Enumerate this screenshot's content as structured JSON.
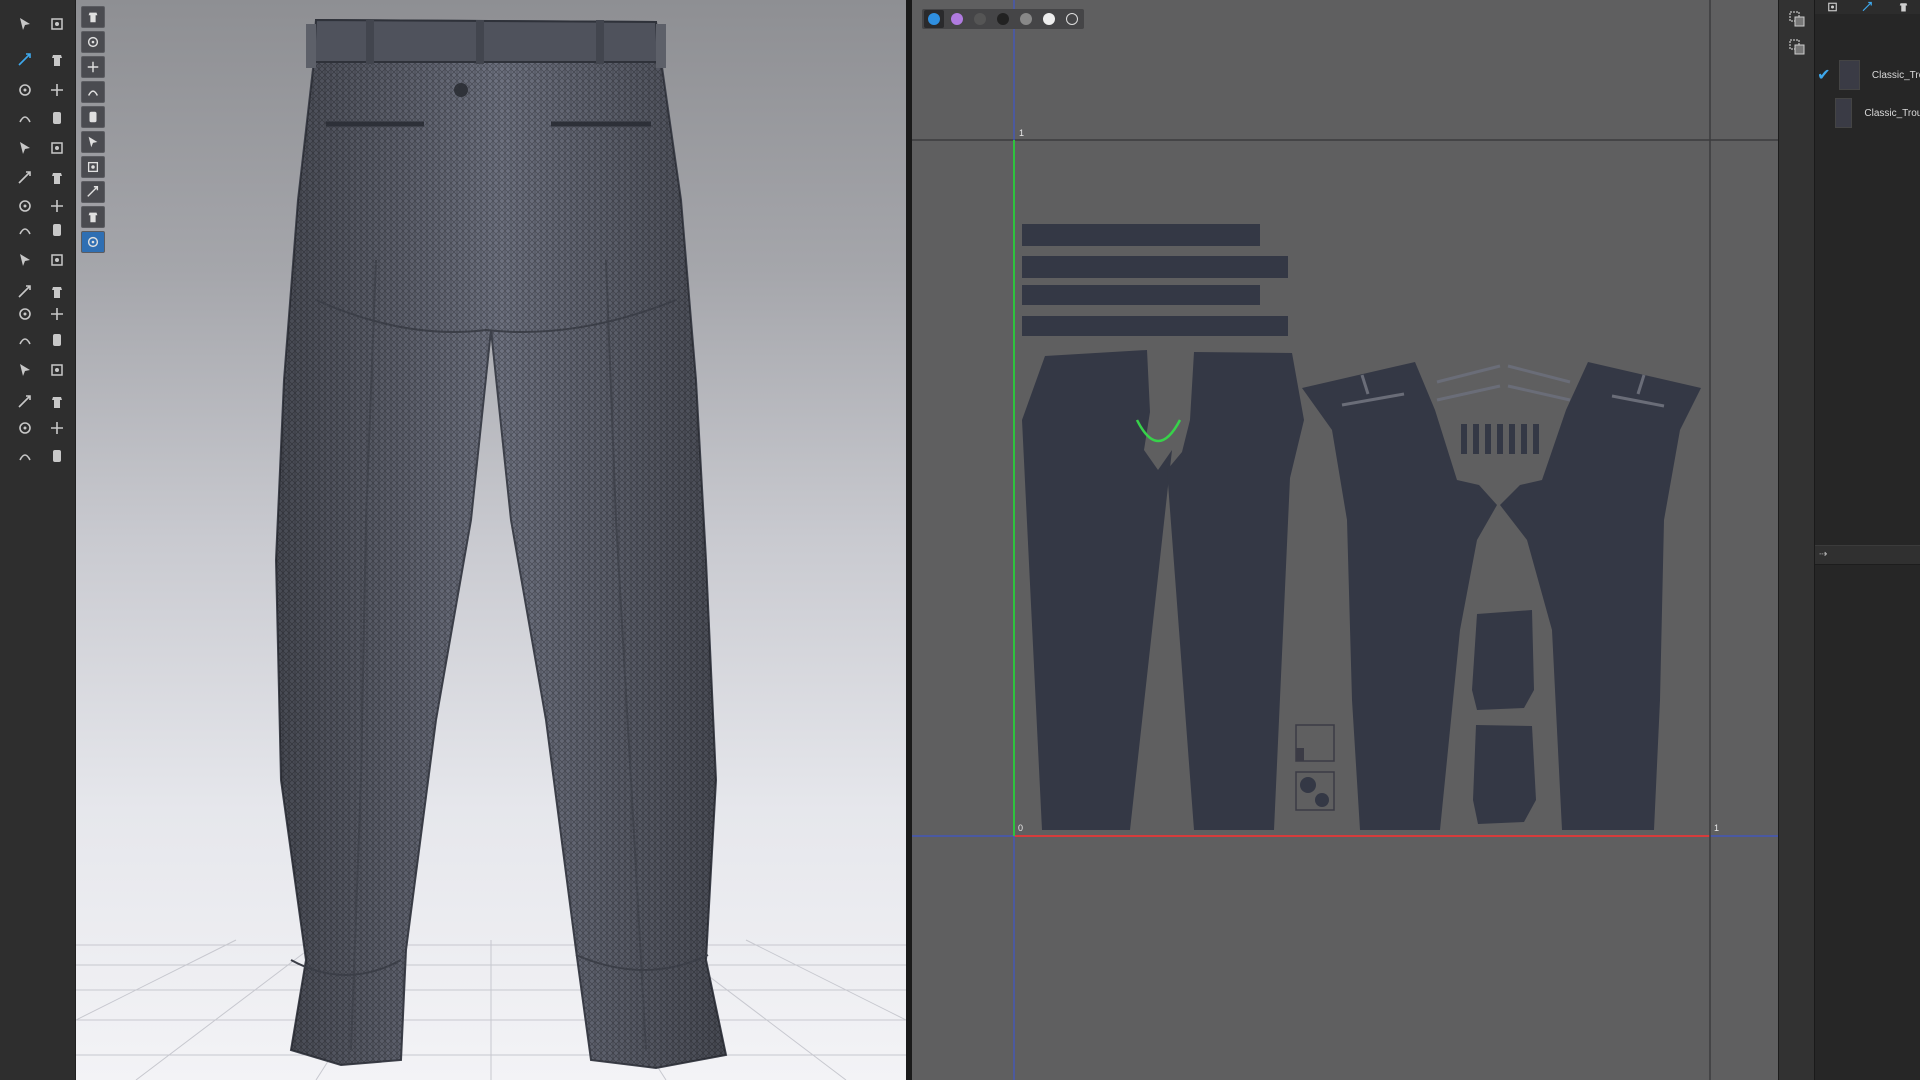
{
  "colors": {
    "pattern_fill": "#343845",
    "seam_highlight": "#37d24a",
    "axis_vertical": "#2ec43e",
    "axis_horizontal": "#d63c3c",
    "selection_check": "#3ea8ec"
  },
  "tool_strip": {
    "tools": [
      "select-move-icon",
      "edit-pattern-icon",
      "transform-pattern-icon",
      "edit-curve-point-icon",
      "add-point-icon",
      "edit-curvature-icon",
      "polygon-icon",
      "rectangle-icon",
      "ellipse-icon",
      "internal-polygon-icon",
      "internal-rectangle-icon",
      "internal-circle-icon",
      "dart-icon",
      "segment-sewing-icon",
      "free-sewing-icon",
      "edit-sewing-icon",
      "fold-arrangement-icon",
      "pin-icon",
      "tack-icon",
      "button-icon",
      "buttonhole-icon",
      "zipper-icon",
      "piping-icon",
      "elastic-icon",
      "topstitch-icon",
      "puckering-icon",
      "texture-edit-icon",
      "graphic-icon",
      "trim-icon",
      "avatar-measure-icon",
      "garment-fit-icon",
      "fold-icon"
    ]
  },
  "viewport_3d": {
    "tools": [
      "simulation-icon",
      "avatar-pose-icon",
      "select-mesh-icon",
      "fabric-icon",
      "avatar-visibility-icon",
      "garment-texture-icon",
      "mesh-quality-icon",
      "avatar-stretch-icon",
      "arrangement-icon",
      "measure-icon"
    ]
  },
  "viewport_2d": {
    "view_modes": [
      "texture-surface-icon",
      "thick-texture-icon",
      "mesh-shaded-icon",
      "dark-shaded-icon",
      "stress-map-icon",
      "white-surface-icon",
      "mesh-wireframe-icon"
    ],
    "axis_labels": {
      "top_left": "1",
      "bottom_left": "0",
      "bottom_right": "1"
    }
  },
  "mini_tools": [
    "uv-select-icon",
    "uv-transform-icon"
  ],
  "object_panel": {
    "tabs": [
      "list-icon",
      "fabric-tab-icon",
      "settings-icon"
    ],
    "items": [
      {
        "label": "Classic_Trouser",
        "checked": true
      },
      {
        "label": "Classic_Trouser_Lining",
        "checked": false
      }
    ],
    "divider_label": "⇢"
  }
}
